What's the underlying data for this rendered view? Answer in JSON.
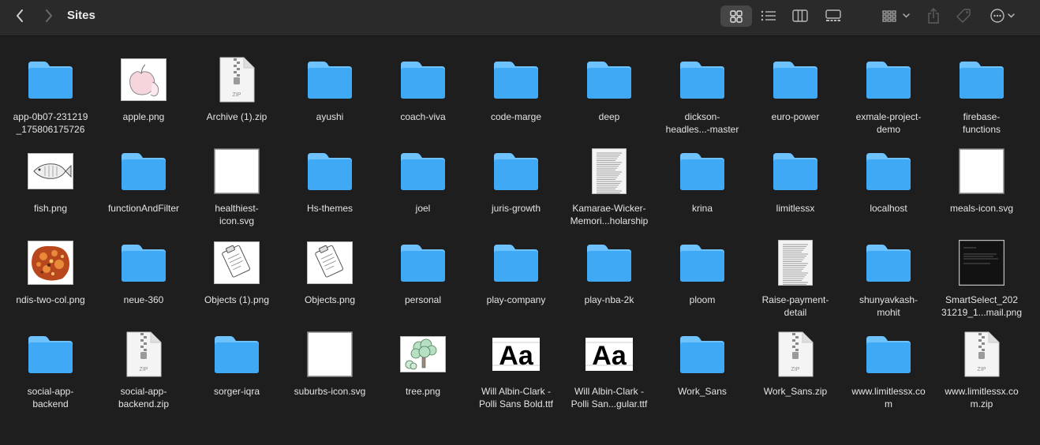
{
  "window": {
    "title": "Sites"
  },
  "toolbar": {
    "back": "chevron-left-icon",
    "forward": "chevron-right-icon",
    "views": [
      "grid-view-icon",
      "list-view-icon",
      "column-view-icon",
      "gallery-view-icon"
    ],
    "active_view": "grid-view-icon",
    "group": "group-by-icon",
    "share": "share-icon",
    "tag": "tag-icon",
    "more": "ellipsis-circle-icon"
  },
  "colors": {
    "folder": "#3fa9f5",
    "folder_top": "#6ec3ff",
    "background": "#1e1e1e",
    "toolbar": "#2a2a2a"
  },
  "items": [
    {
      "label": "app-0b07-231219\n_175806175726",
      "kind": "folder"
    },
    {
      "label": "apple.png",
      "kind": "image-apple"
    },
    {
      "label": "Archive (1).zip",
      "kind": "zip"
    },
    {
      "label": "ayushi",
      "kind": "folder"
    },
    {
      "label": "coach-viva",
      "kind": "folder"
    },
    {
      "label": "code-marge",
      "kind": "folder"
    },
    {
      "label": "deep",
      "kind": "folder"
    },
    {
      "label": "dickson-\nheadles...-master",
      "kind": "folder"
    },
    {
      "label": "euro-power",
      "kind": "folder"
    },
    {
      "label": "exmale-project-\ndemo",
      "kind": "folder"
    },
    {
      "label": "firebase-\nfunctions",
      "kind": "folder"
    },
    {
      "label": "fish.png",
      "kind": "image-fish"
    },
    {
      "label": "functionAndFilter",
      "kind": "folder"
    },
    {
      "label": "healthiest-\nicon.svg",
      "kind": "svg-blank"
    },
    {
      "label": "Hs-themes",
      "kind": "folder"
    },
    {
      "label": "joel",
      "kind": "folder"
    },
    {
      "label": "juris-growth",
      "kind": "folder"
    },
    {
      "label": "Kamarae-Wicker-\nMemori...holarship",
      "kind": "document"
    },
    {
      "label": "krina",
      "kind": "folder"
    },
    {
      "label": "limitlessx",
      "kind": "folder"
    },
    {
      "label": "localhost",
      "kind": "folder"
    },
    {
      "label": "meals-icon.svg",
      "kind": "svg-blank"
    },
    {
      "label": "ndis-two-col.png",
      "kind": "image-food"
    },
    {
      "label": "neue-360",
      "kind": "folder"
    },
    {
      "label": "Objects (1).png",
      "kind": "image-clipboard"
    },
    {
      "label": "Objects.png",
      "kind": "image-clipboard"
    },
    {
      "label": "personal",
      "kind": "folder"
    },
    {
      "label": "play-company",
      "kind": "folder"
    },
    {
      "label": "play-nba-2k",
      "kind": "folder"
    },
    {
      "label": "ploom",
      "kind": "folder"
    },
    {
      "label": "Raise-payment-\ndetail",
      "kind": "document"
    },
    {
      "label": "shunyavkash-\nmohit",
      "kind": "folder"
    },
    {
      "label": "SmartSelect_202\n31219_1...mail.png",
      "kind": "image-dark"
    },
    {
      "label": "social-app-\nbackend",
      "kind": "folder"
    },
    {
      "label": "social-app-\nbackend.zip",
      "kind": "zip"
    },
    {
      "label": "sorger-iqra",
      "kind": "folder"
    },
    {
      "label": "suburbs-icon.svg",
      "kind": "svg-blank"
    },
    {
      "label": "tree.png",
      "kind": "image-tree"
    },
    {
      "label": "Will Albin-Clark -\nPolli Sans Bold.ttf",
      "kind": "font"
    },
    {
      "label": "Will Albin-Clark -\nPolli San...gular.ttf",
      "kind": "font"
    },
    {
      "label": "Work_Sans",
      "kind": "folder"
    },
    {
      "label": "Work_Sans.zip",
      "kind": "zip"
    },
    {
      "label": "www.limitlessx.co\nm",
      "kind": "folder"
    },
    {
      "label": "www.limitlessx.co\nm.zip",
      "kind": "zip"
    }
  ]
}
